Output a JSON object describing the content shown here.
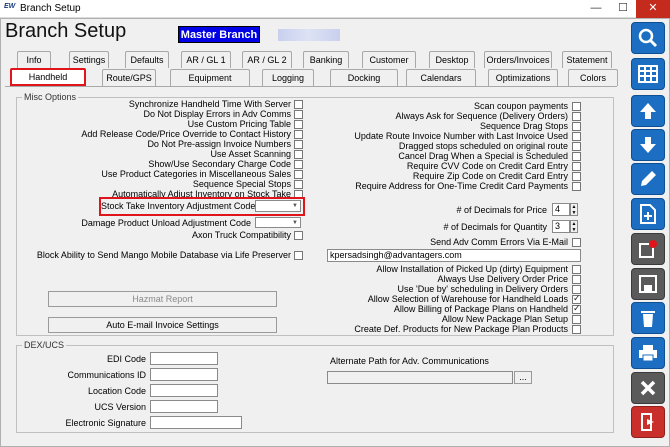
{
  "window": {
    "title": "Branch Setup",
    "minimize": "—",
    "maximize": "☐",
    "close": "✕"
  },
  "header": {
    "title": "Branch Setup",
    "master_branch": "Master Branch"
  },
  "tabs_row1": [
    "Info",
    "Settings",
    "Defaults",
    "AR / GL 1",
    "AR / GL 2",
    "Banking",
    "Customer",
    "Desktop",
    "Orders/Invoices",
    "Statement"
  ],
  "tabs_row2": [
    "Handheld",
    "Route/GPS",
    "Equipment",
    "Logging",
    "Docking",
    "Calendars",
    "Optimizations",
    "Colors"
  ],
  "misc": {
    "group_label": "Misc Options",
    "left_checks": [
      {
        "label": "Synchronize Handheld Time With Server",
        "checked": false
      },
      {
        "label": "Do Not Display Errors in Adv Comms",
        "checked": false
      },
      {
        "label": "Use Custom Pricing Table",
        "checked": false
      },
      {
        "label": "Add Release Code/Price Override to Contact History",
        "checked": false
      },
      {
        "label": "Do Not Pre-assign Invoice Numbers",
        "checked": false
      },
      {
        "label": "Use Asset Scanning",
        "checked": false
      },
      {
        "label": "Show/Use Secondary Charge Code",
        "checked": false
      },
      {
        "label": "Use Product Categories in Miscellaneous Sales",
        "checked": false
      },
      {
        "label": "Sequence Special Stops",
        "checked": false
      },
      {
        "label": "Automatically Adjust Inventory on Stock Take",
        "checked": false
      }
    ],
    "stock_take_label": "Stock Take Inventory Adjustment Code",
    "damage_label": "Damage Product Unload Adjustment Code",
    "axon_label": "Axon Truck Compatibility",
    "block_label": "Block Ability to Send Mango Mobile Database via Life Preserver",
    "right_checks": [
      {
        "label": "Scan coupon payments",
        "checked": false
      },
      {
        "label": "Always Ask for Sequence (Delivery Orders)",
        "checked": false
      },
      {
        "label": "Sequence Drag Stops",
        "checked": false
      },
      {
        "label": "Update Route Invoice Number with Last Invoice Used",
        "checked": false
      },
      {
        "label": "Dragged stops scheduled on original route",
        "checked": false
      },
      {
        "label": "Cancel Drag When a Special is Scheduled",
        "checked": false
      },
      {
        "label": "Require CVV Code on Credit Card Entry",
        "checked": false
      },
      {
        "label": "Require Zip Code on Credit Card Entry",
        "checked": false
      },
      {
        "label": "Require Address for One-Time Credit Card Payments",
        "checked": false
      }
    ],
    "decimals_price_label": "# of Decimals for Price",
    "decimals_price": "4",
    "decimals_qty_label": "# of Decimals for Quantity",
    "decimals_qty": "3",
    "send_adv_label": "Send Adv Comm Errors Via E-Mail",
    "email_value": "kpersadsingh@advantagers.com",
    "right_checks2": [
      {
        "label": "Allow Installation of Picked Up (dirty) Equipment",
        "checked": false
      },
      {
        "label": "Always Use Delivery Order Price",
        "checked": false
      },
      {
        "label": "Use 'Due by' scheduling in Delivery Orders",
        "checked": false
      },
      {
        "label": "Allow Selection of Warehouse for Handheld Loads",
        "checked": true
      },
      {
        "label": "Allow Billing of Package Plans on Handheld",
        "checked": true
      },
      {
        "label": "Allow New Package Plan Setup",
        "checked": false
      },
      {
        "label": "Create Def. Products for New Package Plan Products",
        "checked": false
      }
    ],
    "hazmat_button": "Hazmat Report",
    "auto_email_button": "Auto E-mail Invoice Settings"
  },
  "dexucs": {
    "group_label": "DEX/UCS",
    "fields": [
      "EDI Code",
      "Communications ID",
      "Location Code",
      "UCS Version",
      "Electronic Signature"
    ],
    "alt_path_label": "Alternate Path for Adv. Communications",
    "browse": "..."
  },
  "sidebar": [
    "search-icon",
    "grid-icon",
    "arrow-up-icon",
    "arrow-down-icon",
    "pencil-icon",
    "new-document-icon",
    "add-item-icon",
    "save-icon",
    "delete-icon",
    "print-icon",
    "cancel-icon",
    "exit-icon"
  ],
  "colors": {
    "accent_blue": "#1b6ec2",
    "highlight_red": "#e0151b",
    "master_bg": "#0000e6"
  }
}
